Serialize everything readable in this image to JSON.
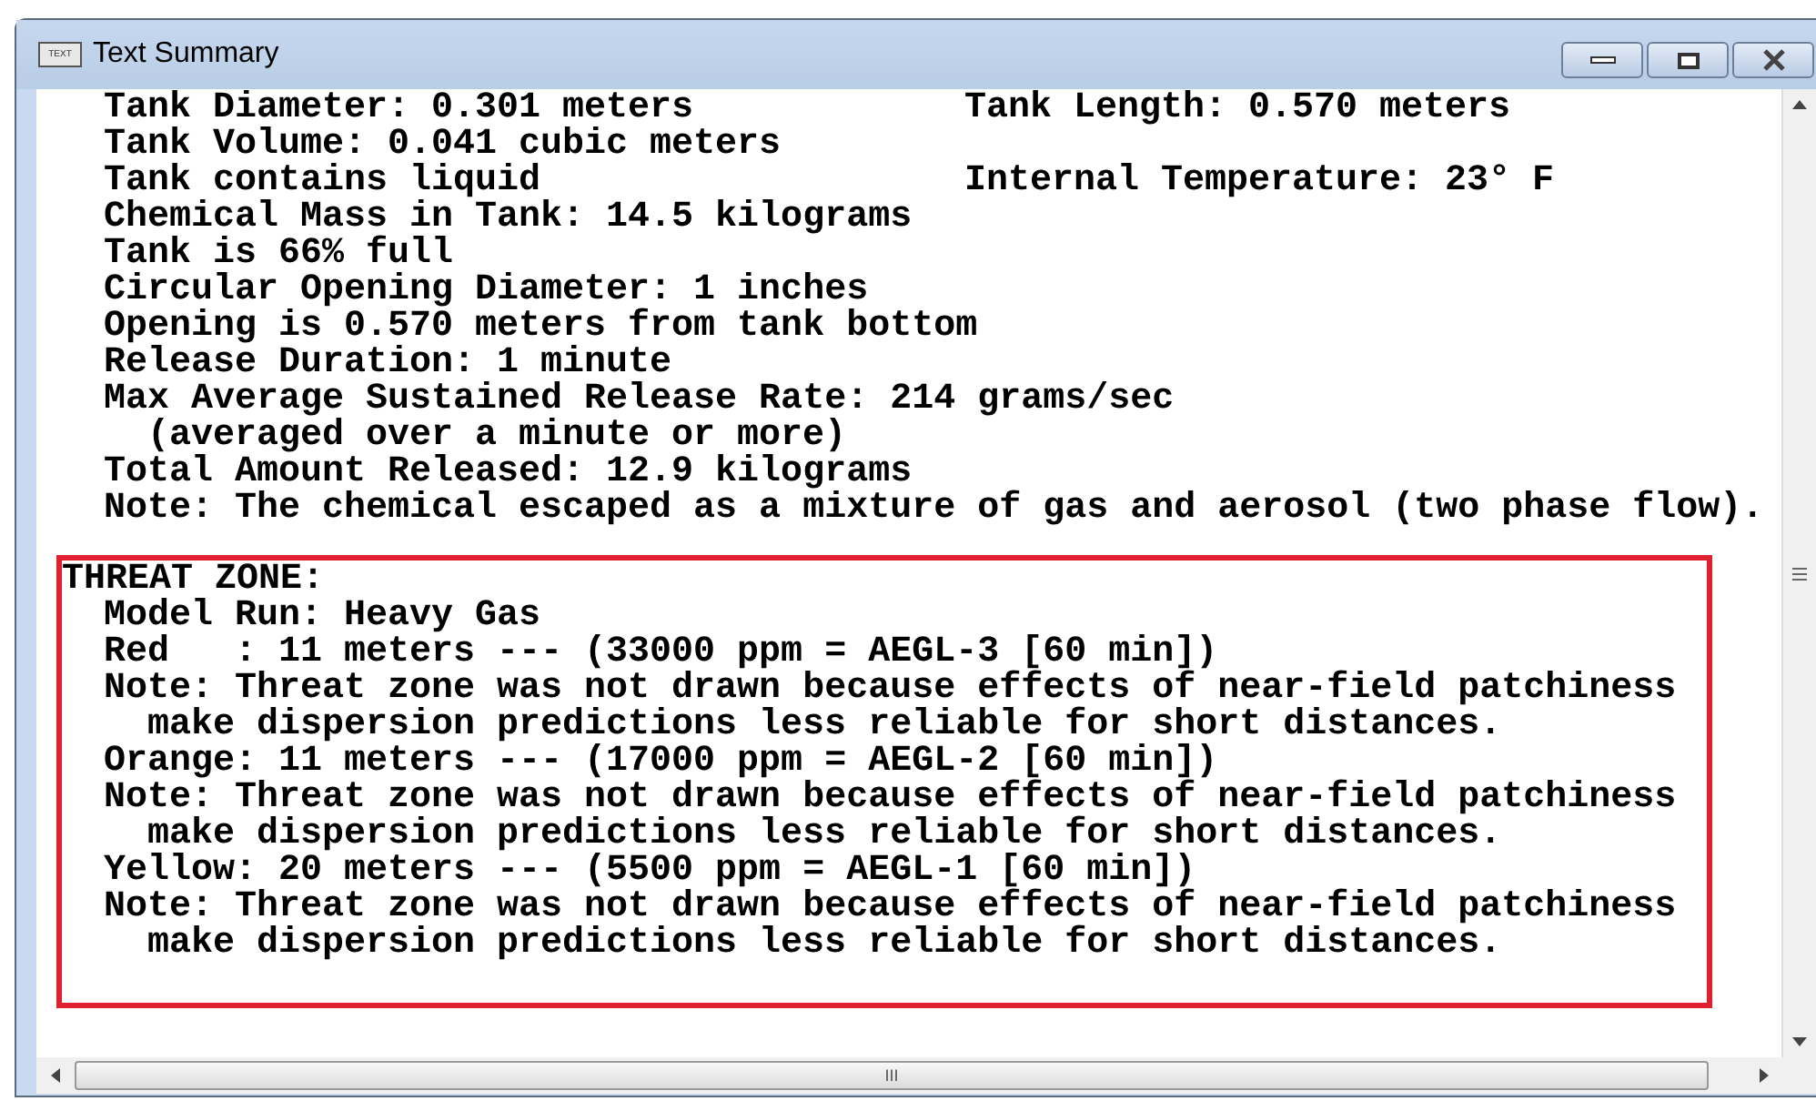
{
  "window": {
    "title": "Text Summary",
    "icon_text": "TEXT"
  },
  "summary": [
    {
      "kind": "line",
      "text": "Tank Diameter: 0.301 meters",
      "right": "Tank Length: 0.570 meters"
    },
    {
      "kind": "line",
      "text": "Tank Volume: 0.041 cubic meters"
    },
    {
      "kind": "line",
      "text": "Tank contains liquid",
      "right": "Internal Temperature: 23° F"
    },
    {
      "kind": "line",
      "text": "Chemical Mass in Tank: 14.5 kilograms"
    },
    {
      "kind": "line",
      "text": "Tank is 66% full"
    },
    {
      "kind": "line",
      "text": "Circular Opening Diameter: 1 inches"
    },
    {
      "kind": "line",
      "text": "Opening is 0.570 meters from tank bottom"
    },
    {
      "kind": "line",
      "text": "Release Duration: 1 minute"
    },
    {
      "kind": "line",
      "text": "Max Average Sustained Release Rate: 214 grams/sec"
    },
    {
      "kind": "continuation",
      "text": "(averaged over a minute or more)"
    },
    {
      "kind": "line",
      "text": "Total Amount Released: 12.9 kilograms"
    },
    {
      "kind": "line",
      "text": "Note: The chemical escaped as a mixture of gas and aerosol (two phase flow)."
    }
  ],
  "threat_zone": {
    "heading": "THREAT ZONE:",
    "lines": [
      {
        "kind": "line",
        "text": "Model Run: Heavy Gas"
      },
      {
        "kind": "line",
        "text": "Red   : 11 meters --- (33000 ppm = AEGL-3 [60 min])"
      },
      {
        "kind": "line",
        "text": "Note: Threat zone was not drawn because effects of near-field patchiness"
      },
      {
        "kind": "continuation",
        "text": "make dispersion predictions less reliable for short distances."
      },
      {
        "kind": "line",
        "text": "Orange: 11 meters --- (17000 ppm = AEGL-2 [60 min])"
      },
      {
        "kind": "line",
        "text": "Note: Threat zone was not drawn because effects of near-field patchiness"
      },
      {
        "kind": "continuation",
        "text": "make dispersion predictions less reliable for short distances."
      },
      {
        "kind": "line",
        "text": "Yellow: 20 meters --- (5500 ppm = AEGL-1 [60 min])"
      },
      {
        "kind": "line",
        "text": "Note: Threat zone was not drawn because effects of near-field patchiness"
      },
      {
        "kind": "continuation",
        "text": "make dispersion predictions less reliable for short distances."
      }
    ]
  },
  "scrollbar": {
    "grip": "III"
  }
}
